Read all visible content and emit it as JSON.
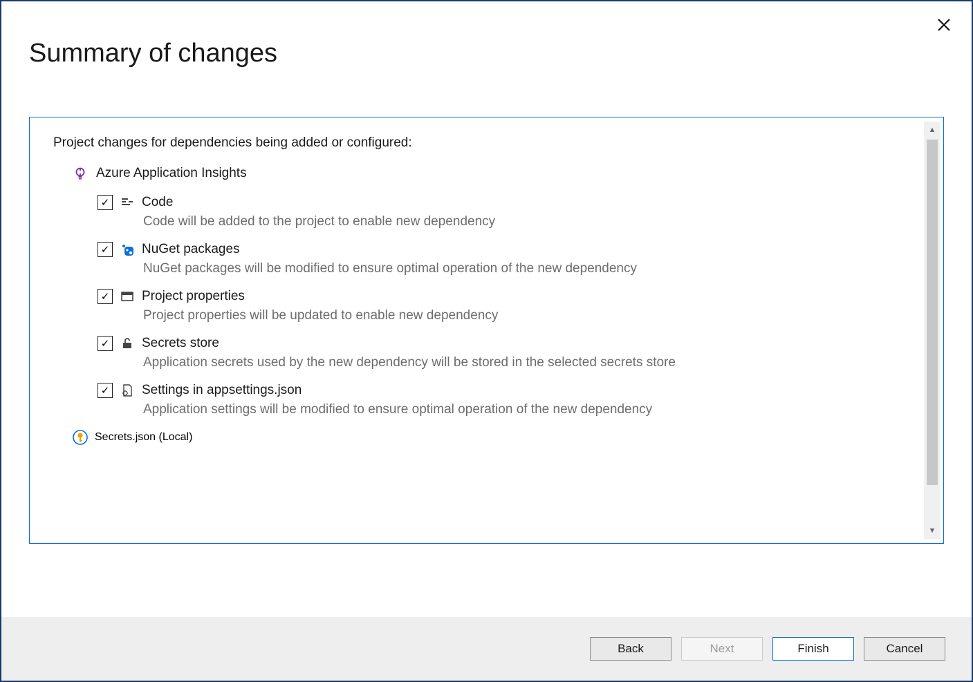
{
  "title": "Summary of changes",
  "intro": "Project changes for dependencies being added or configured:",
  "group1": {
    "label": "Azure Application Insights"
  },
  "items": [
    {
      "title": "Code",
      "desc": "Code will be added to the project to enable new dependency",
      "checked": true
    },
    {
      "title": "NuGet packages",
      "desc": "NuGet packages will be modified to ensure optimal operation of the new dependency",
      "checked": true
    },
    {
      "title": "Project properties",
      "desc": "Project properties will be updated to enable new dependency",
      "checked": true
    },
    {
      "title": "Secrets store",
      "desc": "Application secrets used by the new dependency will be stored in the selected secrets store",
      "checked": true
    },
    {
      "title": "Settings in appsettings.json",
      "desc": "Application settings will be modified to ensure optimal operation of the new dependency",
      "checked": true
    }
  ],
  "group2": {
    "label": "Secrets.json (Local)"
  },
  "buttons": {
    "back": "Back",
    "next": "Next",
    "finish": "Finish",
    "cancel": "Cancel"
  }
}
